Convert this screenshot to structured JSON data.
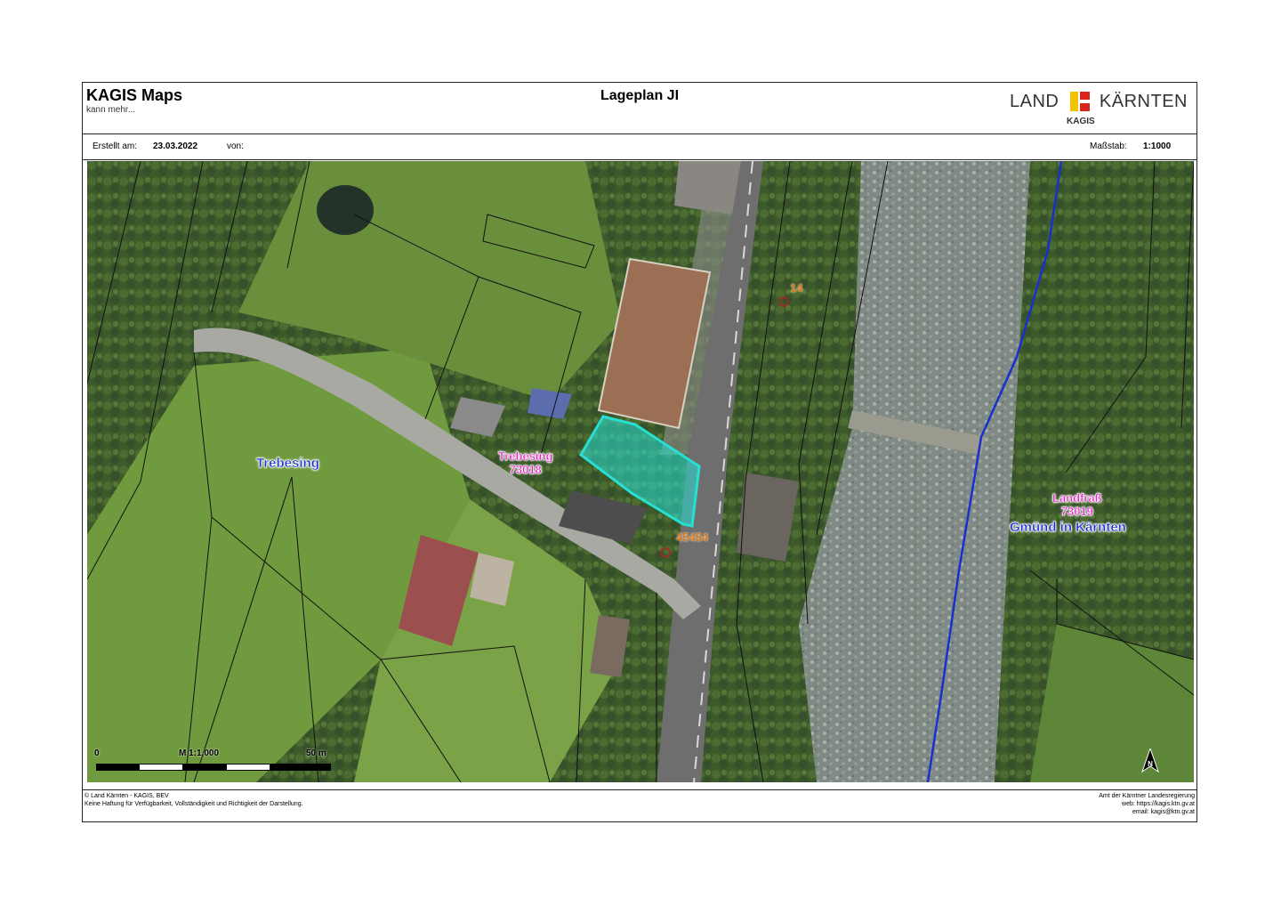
{
  "header": {
    "brand_title": "KAGIS Maps",
    "brand_subtitle": "kann mehr...",
    "document_title": "Lageplan JI",
    "logo_left": "LAND",
    "logo_right": "KÄRNTEN",
    "logo_sub": "KAGIS"
  },
  "meta": {
    "created_label": "Erstellt am:",
    "created_date": "23.03.2022",
    "by_label": "von:",
    "by_value": "",
    "scale_label": "Maßstab:",
    "scale_value": "1:1000"
  },
  "map_labels": {
    "trebesing_area": "Trebesing",
    "cadastral_left_name": "Trebesing",
    "cadastral_left_id": "73018",
    "cadastral_right_name": "Landfraß",
    "cadastral_right_id": "73019",
    "municipality_right": "Gmünd in Kärnten",
    "parcel_14": "14",
    "parcel_45454": "45454"
  },
  "scalebar": {
    "start": "0",
    "middle": "M 1:1,000",
    "end": "50 m"
  },
  "north_arrow": {
    "letter": "N"
  },
  "footer": {
    "left_line1": "© Land Kärnten - KAGIS, BEV",
    "left_line2": "Keine Haftung für Verfügbarkeit, Vollständigkeit und Richtigkeit der Darstellung.",
    "right_line1": "Amt der Kärntner Landesregierung",
    "right_line2": "web: https://kagis.ktn.gv.at",
    "right_line3": "email: kagis@ktn.gv.at"
  },
  "colors": {
    "parcel_highlight": "#27e0d4",
    "municipal_boundary": "#1a2fd0",
    "label_blue": "#1a2fd0",
    "label_pink": "#e31ec5",
    "label_orange": "#d97a19",
    "logo_red": "#d9261c",
    "logo_yellow": "#f2c300"
  },
  "icons": {
    "north_arrow": "north-arrow-icon",
    "logo_mark": "kaernten-logo-icon"
  }
}
